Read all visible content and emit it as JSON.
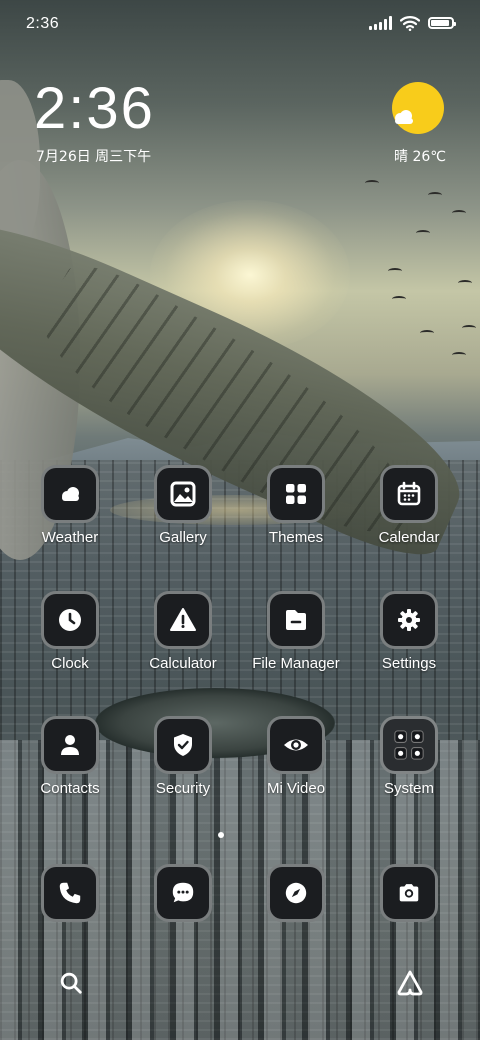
{
  "status_bar": {
    "time": "2:36",
    "battery_level": 0.9
  },
  "clock_widget": {
    "time": "2:36",
    "date": "7月26日 周三下午"
  },
  "weather_widget": {
    "condition_icon": "sun-behind-cloud",
    "text": "晴 26℃"
  },
  "apps": [
    {
      "label": "Weather",
      "icon": "cloud-icon"
    },
    {
      "label": "Gallery",
      "icon": "image-icon"
    },
    {
      "label": "Themes",
      "icon": "grid-icon"
    },
    {
      "label": "Calendar",
      "icon": "calendar-icon"
    },
    {
      "label": "Clock",
      "icon": "clock-icon"
    },
    {
      "label": "Calculator",
      "icon": "warning-icon"
    },
    {
      "label": "File Manager",
      "icon": "folder-icon"
    },
    {
      "label": "Settings",
      "icon": "gear-icon"
    },
    {
      "label": "Contacts",
      "icon": "person-icon"
    },
    {
      "label": "Security",
      "icon": "shield-icon"
    },
    {
      "label": "Mi Video",
      "icon": "eye-icon"
    },
    {
      "label": "System",
      "icon": "folder-grid-icon"
    }
  ],
  "dock": [
    {
      "icon": "phone-icon"
    },
    {
      "icon": "message-icon"
    },
    {
      "icon": "compass-icon"
    },
    {
      "icon": "camera-icon"
    }
  ],
  "page_indicator": {
    "current": 1,
    "total": 1
  },
  "bottom_bar": {
    "left_icon": "search-icon",
    "right_icon": "assistant-icon"
  }
}
